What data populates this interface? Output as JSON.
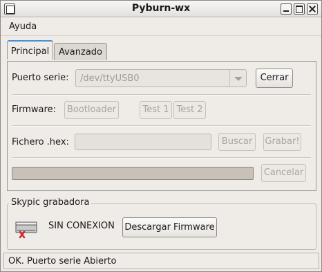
{
  "window": {
    "title": "Pyburn-wx"
  },
  "menubar": {
    "items": [
      {
        "label": "Ayuda"
      }
    ]
  },
  "tabs": [
    {
      "label": "Principal",
      "active": true
    },
    {
      "label": "Avanzado",
      "active": false
    }
  ],
  "principal": {
    "port_label": "Puerto serie:",
    "port_value": "/dev/ttyUSB0",
    "close_label": "Cerrar",
    "firmware_label": "Firmware:",
    "bootloader_label": "Bootloader",
    "test1_label": "Test 1",
    "test2_label": "Test 2",
    "hex_label": "Fichero .hex:",
    "hex_value": "",
    "browse_label": "Buscar",
    "burn_label": "Grabar!",
    "progress": 0,
    "cancel_label": "Cancelar"
  },
  "group": {
    "title": "Skypic grabadora",
    "icon": "disconnected-device-icon",
    "status": "SIN CONEXION",
    "download_label": "Descargar Firmware"
  },
  "statusbar": {
    "text": "OK. Puerto serie Abierto"
  },
  "colors": {
    "accent": "#4a90d9",
    "window_bg": "#efebe7",
    "disconnect_mark": "#d0262b"
  }
}
